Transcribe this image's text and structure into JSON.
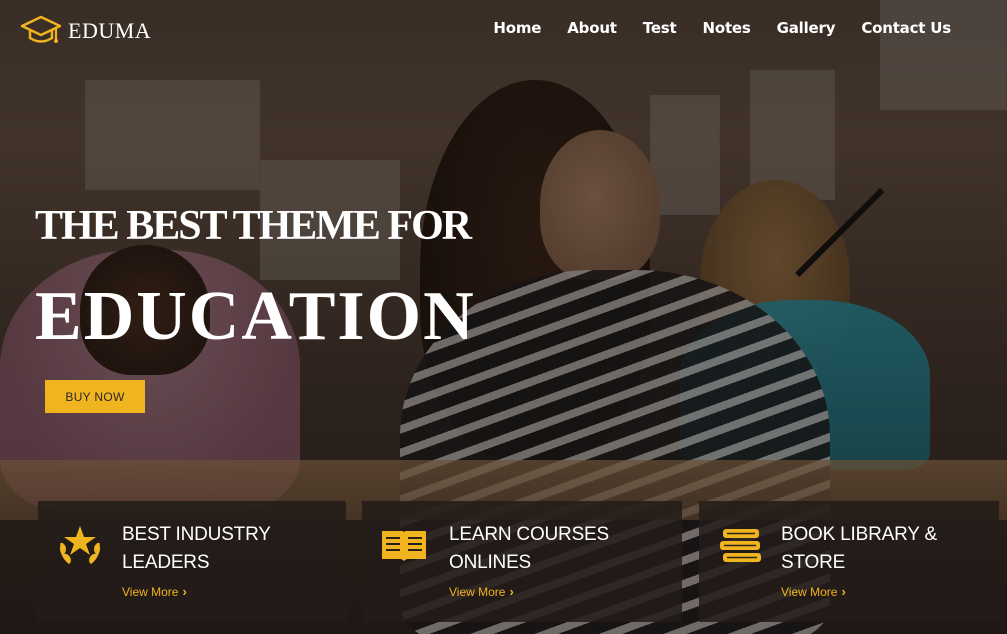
{
  "brand": {
    "name": "EDUMA",
    "icon": "graduation-cap-icon",
    "accent_color": "#f0b41e"
  },
  "nav": {
    "items": [
      {
        "label": "Home"
      },
      {
        "label": "About"
      },
      {
        "label": "Test"
      },
      {
        "label": "Notes"
      },
      {
        "label": "Gallery"
      },
      {
        "label": "Contact Us"
      }
    ]
  },
  "hero": {
    "title": "THE BEST THEME FOR",
    "subtitle": "EDUCATION",
    "cta_label": "BUY NOW"
  },
  "features": [
    {
      "title_line1": "BEST INDUSTRY",
      "title_line2": "LEADERS",
      "link": "View More",
      "icon": "award-star-icon"
    },
    {
      "title_line1": "LEARN COURSES",
      "title_line2": "ONLINES",
      "link": "View More",
      "icon": "open-book-icon"
    },
    {
      "title_line1": "BOOK LIBRARY &",
      "title_line2": "STORE",
      "link": "View More",
      "icon": "book-stack-icon"
    }
  ]
}
